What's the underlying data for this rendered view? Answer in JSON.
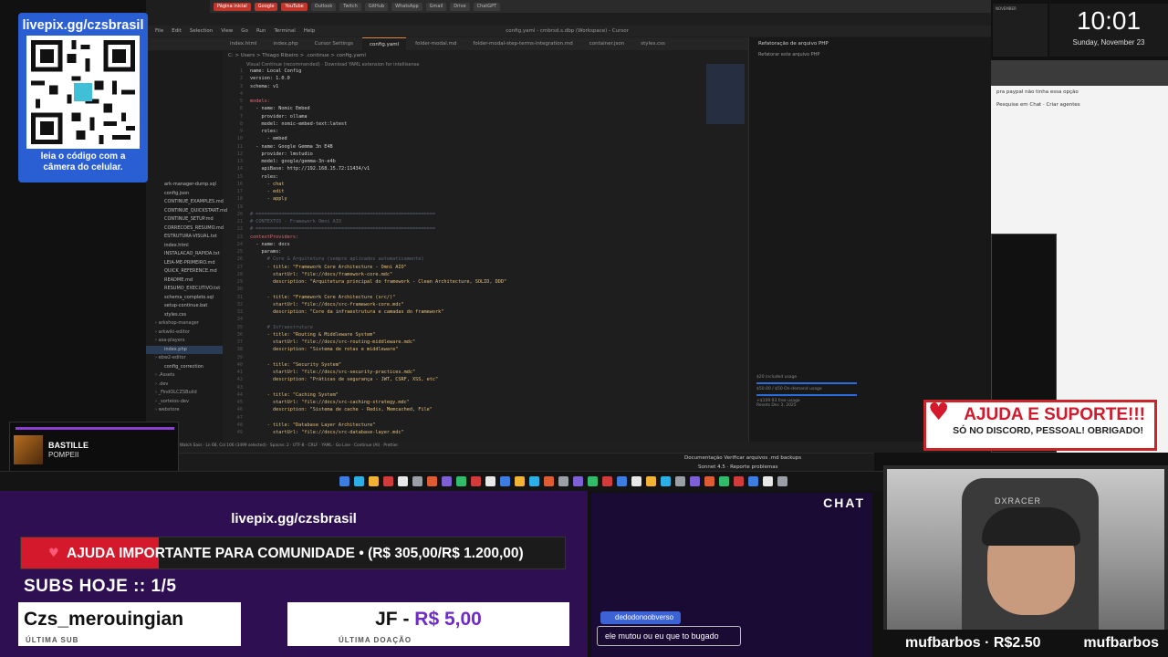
{
  "browser": {
    "tabs": [
      "Página inicial",
      "Google",
      "YouTube",
      "Outlook",
      "Twitch",
      "GitHub",
      "WhatsApp",
      "Gmail",
      "Drive",
      "ChatGPT"
    ]
  },
  "ide": {
    "menu": [
      "File",
      "Edit",
      "Selection",
      "View",
      "Go",
      "Run",
      "Terminal",
      "Help"
    ],
    "window_title": "config.yaml - cmbrsd.s.dbp (Workspace) - Cursor",
    "tabs": [
      {
        "label": "index.html"
      },
      {
        "label": "index.php"
      },
      {
        "label": "Cursor Settings"
      },
      {
        "label": "config.yaml",
        "active": true
      },
      {
        "label": "folder-modal.md"
      },
      {
        "label": "folder-modal-step-terms-integration.md"
      },
      {
        "label": "container.json"
      },
      {
        "label": "styles.css"
      }
    ],
    "breadcrumb": "C: > Users > Thiago Ribeiro > .continue > config.yaml",
    "notice": "Visual Continue (recommended) · Download YAML extension for intellisense",
    "explorer_files": [
      {
        "name": "ark-manager-dump.sql"
      },
      {
        "name": "config.json"
      },
      {
        "name": "CONTINUE_EXAMPLES.md"
      },
      {
        "name": "CONTINUE_QUICKSTART.md"
      },
      {
        "name": "CONTINUE_SETUP.md"
      },
      {
        "name": "CORRECOES_RESUMO.md"
      },
      {
        "name": "ESTRUTURA-VISUAL.txt"
      },
      {
        "name": "index.html"
      },
      {
        "name": "INSTALACAO_RAPIDA.txt"
      },
      {
        "name": "LEIA-ME-PRIMEIRO.md"
      },
      {
        "name": "QUICK_REFERENCE.md"
      },
      {
        "name": "README.md"
      },
      {
        "name": "RESUMO_EXECUTIVO.txt"
      },
      {
        "name": "schema_completo.sql"
      },
      {
        "name": "setup-continue.bat"
      },
      {
        "name": "styles.css"
      },
      {
        "name": "arkshop-manager",
        "dir": true
      },
      {
        "name": "arkwiki-editor",
        "dir": true
      },
      {
        "name": "asa-players",
        "dir": true
      },
      {
        "name": "index.php",
        "sel": true
      },
      {
        "name": "ebw2-editor",
        "dir": true
      },
      {
        "name": "config_correction"
      },
      {
        "name": ".Assets",
        "dir": true
      },
      {
        "name": ".dev",
        "dir": true
      },
      {
        "name": "_FindOLCZSBuild",
        "dir": true
      },
      {
        "name": "_sorteios-dev",
        "dir": true
      },
      {
        "name": "webstore",
        "dir": true
      }
    ],
    "code": [
      {
        "n": "1",
        "t": "name: Local Config",
        "cls": ""
      },
      {
        "n": "2",
        "t": "version: 1.0.0",
        "cls": ""
      },
      {
        "n": "3",
        "t": "schema: v1",
        "cls": ""
      },
      {
        "n": "4",
        "t": "",
        "cls": ""
      },
      {
        "n": "5",
        "t": "models:",
        "cls": "k"
      },
      {
        "n": "6",
        "t": "  - name: Nomic Embed",
        "cls": ""
      },
      {
        "n": "7",
        "t": "    provider: ollama",
        "cls": ""
      },
      {
        "n": "8",
        "t": "    model: nomic-embed-text:latest",
        "cls": ""
      },
      {
        "n": "9",
        "t": "    roles:",
        "cls": ""
      },
      {
        "n": "10",
        "t": "      - embed",
        "cls": ""
      },
      {
        "n": "11",
        "t": "  - name: Google Gemma 3n E4B",
        "cls": ""
      },
      {
        "n": "12",
        "t": "    provider: lmstudio",
        "cls": ""
      },
      {
        "n": "13",
        "t": "    model: google/gemma-3n-e4b",
        "cls": ""
      },
      {
        "n": "14",
        "t": "    apiBase: http://192.168.15.72:11434/v1",
        "cls": ""
      },
      {
        "n": "15",
        "t": "    roles:",
        "cls": ""
      },
      {
        "n": "16",
        "t": "      - chat",
        "cls": "s"
      },
      {
        "n": "17",
        "t": "      - edit",
        "cls": "s"
      },
      {
        "n": "18",
        "t": "      - apply",
        "cls": "s"
      },
      {
        "n": "19",
        "t": "",
        "cls": ""
      },
      {
        "n": "20",
        "t": "# ===============================================================",
        "cls": "c"
      },
      {
        "n": "21",
        "t": "# CONTEXTOS - Framework Omni AIO",
        "cls": "c"
      },
      {
        "n": "22",
        "t": "# ===============================================================",
        "cls": "c"
      },
      {
        "n": "23",
        "t": "contextProviders:",
        "cls": "k"
      },
      {
        "n": "24",
        "t": "  - name: docs",
        "cls": ""
      },
      {
        "n": "25",
        "t": "    params:",
        "cls": ""
      },
      {
        "n": "26",
        "t": "      # Core & Arquitetura (sempre aplicados automaticamente)",
        "cls": "c"
      },
      {
        "n": "27",
        "t": "      - title: \"Framework Core Architecture - Omni AIO\"",
        "cls": "s"
      },
      {
        "n": "28",
        "t": "        startUrl: \"file://docs/framework-core.mdc\"",
        "cls": "s"
      },
      {
        "n": "29",
        "t": "        description: \"Arquitetura principal do framework - Clean Architecture, SOLID, DDD\"",
        "cls": "s"
      },
      {
        "n": "30",
        "t": "",
        "cls": ""
      },
      {
        "n": "31",
        "t": "      - title: \"Framework Core Architecture (src/)\"",
        "cls": "s"
      },
      {
        "n": "32",
        "t": "        startUrl: \"file://docs/src-framework-core.mdc\"",
        "cls": "s"
      },
      {
        "n": "33",
        "t": "        description: \"Core da infraestrutura e camadas do framework\"",
        "cls": "s"
      },
      {
        "n": "34",
        "t": "",
        "cls": ""
      },
      {
        "n": "35",
        "t": "      # Infraestrutura",
        "cls": "c"
      },
      {
        "n": "36",
        "t": "      - title: \"Routing & Middleware System\"",
        "cls": "s"
      },
      {
        "n": "37",
        "t": "        startUrl: \"file://docs/src-routing-middleware.mdc\"",
        "cls": "s"
      },
      {
        "n": "38",
        "t": "        description: \"Sistema de rotas e middleware\"",
        "cls": "s"
      },
      {
        "n": "39",
        "t": "",
        "cls": ""
      },
      {
        "n": "40",
        "t": "      - title: \"Security System\"",
        "cls": "s"
      },
      {
        "n": "41",
        "t": "        startUrl: \"file://docs/src-security-practices.mdc\"",
        "cls": "s"
      },
      {
        "n": "42",
        "t": "        description: \"Práticas de segurança - JWT, CSRF, XSS, etc\"",
        "cls": "s"
      },
      {
        "n": "43",
        "t": "",
        "cls": ""
      },
      {
        "n": "44",
        "t": "      - title: \"Caching System\"",
        "cls": "s"
      },
      {
        "n": "45",
        "t": "        startUrl: \"file://docs/src-caching-strategy.mdc\"",
        "cls": "s"
      },
      {
        "n": "46",
        "t": "        description: \"Sistema de cache - Redis, Memcached, File\"",
        "cls": "s"
      },
      {
        "n": "47",
        "t": "",
        "cls": ""
      },
      {
        "n": "48",
        "t": "      - title: \"Database Layer Architecture\"",
        "cls": "s"
      },
      {
        "n": "49",
        "t": "        startUrl: \"file://docs/src-database-layer.mdc\"",
        "cls": "s"
      }
    ],
    "chat_panel": {
      "header": "Refatoração de arquivo PHP",
      "sub": "Refatorar este arquivo PHP"
    },
    "usage": {
      "line1": "$20 included usage",
      "line2": "$50.00 / $50 On-demand usage",
      "line3": "+$109.93 free usage",
      "line4": "Resets Dec 3, 2025"
    },
    "status": "Cursor Tab · Watch Sass · Ln 68, Col 106 (3499 selected) · Spaces: 2 · UTF-8 · CRLF · YAML · Go Live · Continue (AI) · Prettier",
    "chat_tbar_doc": "Documentação Verificar arquivos .md backups",
    "chat_tbar_doc2": "Sonnet 4.5 · Reporte problemas"
  },
  "right_window": {
    "hint": "pra paypal não tinha essa opção",
    "search": "Pesquise em Chat · Criar agentes"
  },
  "clock": {
    "time": "10:01",
    "date": "Sunday, November 23",
    "cal_month": "NOVEMBER"
  },
  "qr": {
    "url": "livepix.gg/czsbrasil",
    "hint": "leia o código com a câmera do celular."
  },
  "now_playing": {
    "artist": "BASTILLE",
    "song": "POMPEII",
    "progress": 0.98
  },
  "support": {
    "line1": "AJUDA E SUPORTE!!!",
    "line2": "SÓ NO DISCORD, PESSOAL! OBRIGADO!"
  },
  "stream": {
    "pix_url": "livepix.gg/czsbrasil",
    "goal_text": "AJUDA IMPORTANTE PARA COMUNIDADE  •  (R$ 305,00/R$ 1.200,00)",
    "goal_progress": 0.254,
    "subs_today": "SUBS HOJE :: 1/5",
    "last_sub_name": "Czs_merouingian",
    "last_sub_caption": "ÚLTIMA SUB",
    "last_donation_name": "JF - ",
    "last_donation_amount": "R$ 5,00",
    "last_donation_caption": "ÚLTIMA DOAÇÃO",
    "chat_header": "CHAT",
    "chat_user": "dedodonoobverso",
    "chat_message": "ele mutou ou eu que to bugado",
    "cam_left": "mufbarbos · R$2.50",
    "cam_right": "mufbarbos",
    "chair_brand": "DXRACER"
  },
  "colors": {
    "purple_panel": "#2d0f52",
    "goal_red": "#d3192b",
    "qr_blue": "#2a5fd4"
  }
}
